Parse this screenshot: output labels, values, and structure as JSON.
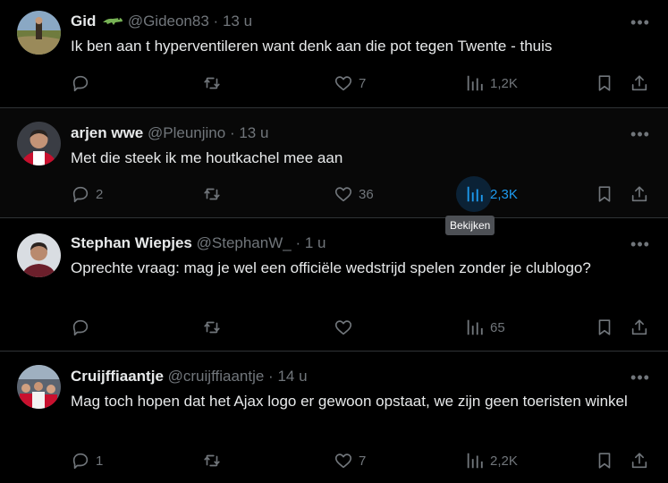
{
  "tweets": [
    {
      "name": "Gid",
      "handle": "@Gideon83",
      "sep": "·",
      "time": "13 u",
      "text": "Ik ben aan t hyperventileren want denk aan die pot tegen Twente - thuis",
      "reply_count": "",
      "like_count": "7",
      "view_count": "1,2K"
    },
    {
      "name": "arjen wwe",
      "handle": "@Pleunjino",
      "sep": "·",
      "time": "13 u",
      "text": "Met die steek ik me houtkachel mee aan",
      "reply_count": "2",
      "like_count": "36",
      "view_count": "2,3K"
    },
    {
      "name": "Stephan Wiepjes",
      "handle": "@StephanW_",
      "sep": "·",
      "time": "1 u",
      "text": "Oprechte vraag: mag je wel een officiële wedstrijd spelen zonder je clublogo?",
      "reply_count": "",
      "like_count": "",
      "view_count": "65"
    },
    {
      "name": "Cruijffiaantje",
      "handle": "@cruijffiaantje",
      "sep": "·",
      "time": "14 u",
      "text": "Mag toch hopen dat het Ajax logo er gewoon opstaat, we zijn geen toeristen winkel",
      "reply_count": "1",
      "like_count": "7",
      "view_count": "2,2K"
    }
  ],
  "tooltip": "Bekijken",
  "more_glyph": "•••",
  "colors": {
    "accent": "#1d9bf0",
    "muted": "#71767b",
    "text": "#e7e9ea",
    "divider": "#2f3336"
  }
}
